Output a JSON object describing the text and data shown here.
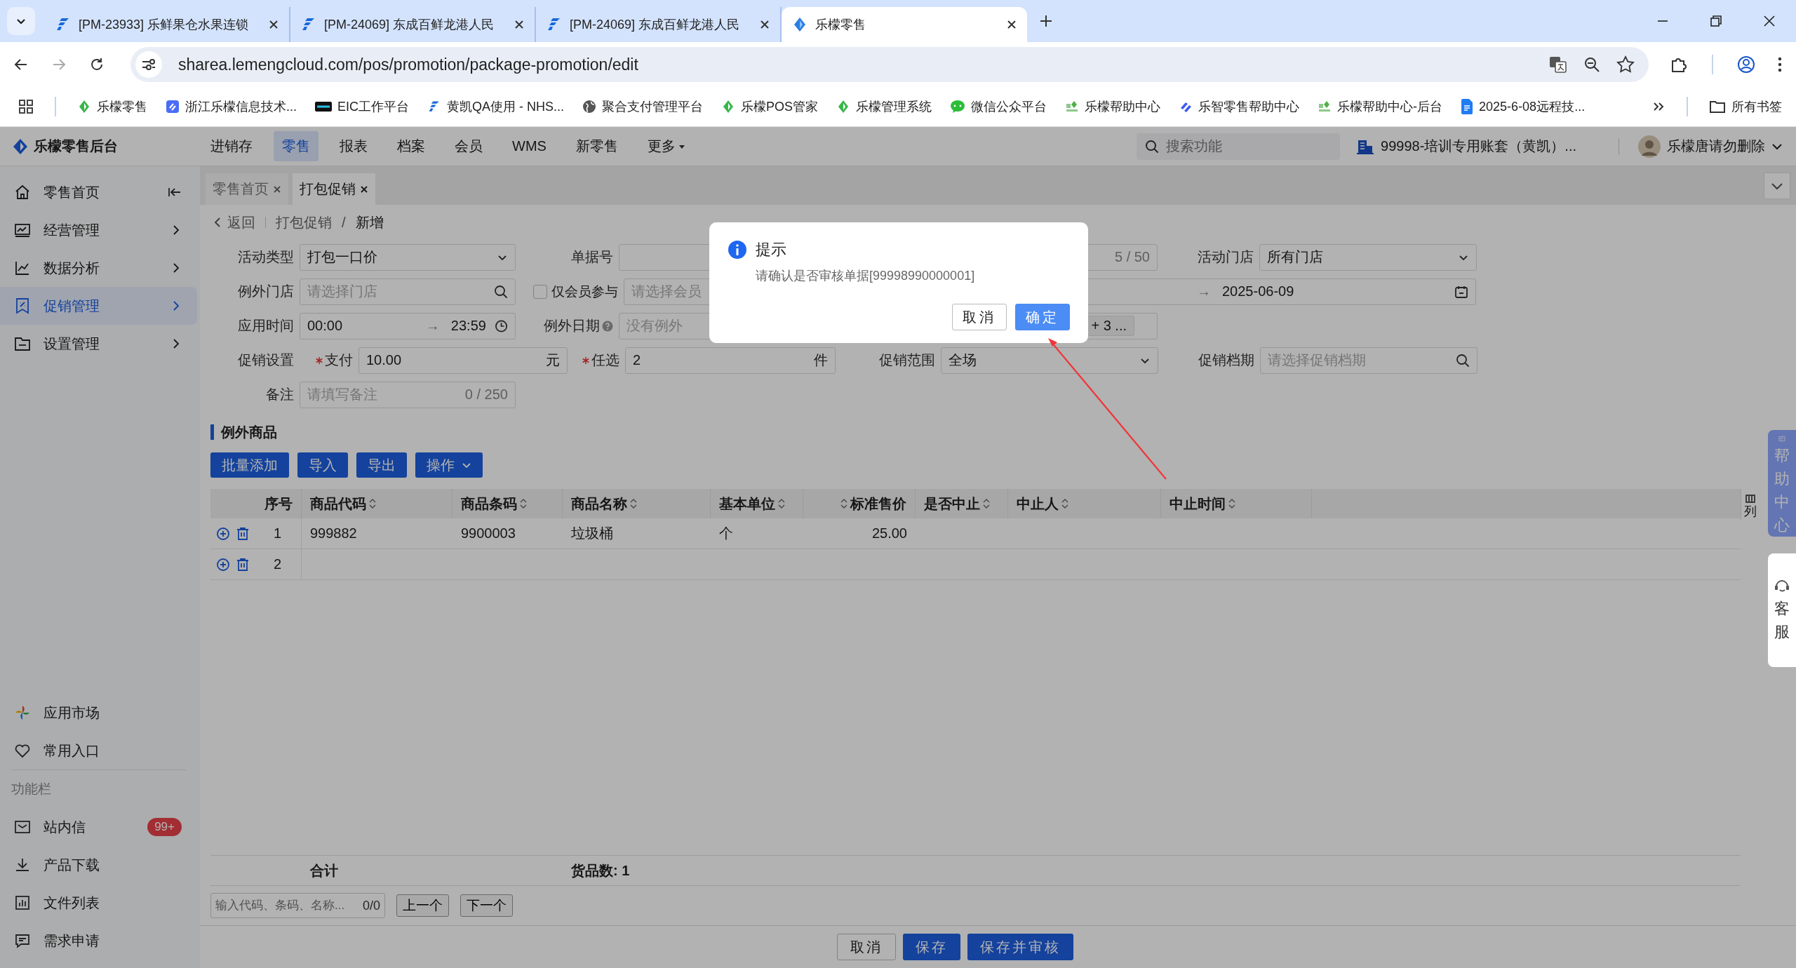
{
  "browser": {
    "tabs": [
      {
        "title": "[PM-23933] 乐鲜果仓水果连锁",
        "selected": false
      },
      {
        "title": "[PM-24069] 东成百鲜龙港人民",
        "selected": false
      },
      {
        "title": "[PM-24069] 东成百鲜龙港人民",
        "selected": false
      },
      {
        "title": "乐檬零售",
        "selected": true
      }
    ],
    "url": "sharea.lemengcloud.com/pos/promotion/package-promotion/edit",
    "bookmarks": [
      "乐檬零售",
      "浙江乐檬信息技术...",
      "EIC工作平台",
      "黄凯QA使用 - NHS...",
      "聚合支付管理平台",
      "乐檬POS管家",
      "乐檬管理系统",
      "微信公众平台",
      "乐檬帮助中心",
      "乐智零售帮助中心",
      "乐檬帮助中心-后台",
      "2025-6-08远程技..."
    ],
    "all_bookmarks": "所有书签"
  },
  "app": {
    "logo": "乐檬零售后台",
    "nav": [
      {
        "label": "进销存",
        "selected": false
      },
      {
        "label": "零售",
        "selected": true
      },
      {
        "label": "报表",
        "selected": false
      },
      {
        "label": "档案",
        "selected": false
      },
      {
        "label": "会员",
        "selected": false
      },
      {
        "label": "WMS",
        "selected": false
      },
      {
        "label": "新零售",
        "selected": false
      },
      {
        "label": "更多",
        "selected": false
      }
    ],
    "search_placeholder": "搜索功能",
    "account": "99998-培训专用账套（黄凯）...",
    "user": "乐檬唐请勿删除"
  },
  "sidebar": {
    "items": [
      {
        "label": "零售首页",
        "selected": false
      },
      {
        "label": "经营管理",
        "selected": false
      },
      {
        "label": "数据分析",
        "selected": false
      },
      {
        "label": "促销管理",
        "selected": true
      },
      {
        "label": "设置管理",
        "selected": false
      }
    ],
    "bottom": [
      "应用市场",
      "常用入口"
    ],
    "section": "功能栏",
    "tools": [
      {
        "label": "站内信",
        "badge": "99+"
      },
      {
        "label": "产品下载"
      },
      {
        "label": "文件列表"
      },
      {
        "label": "需求申请"
      }
    ]
  },
  "page_tabs": [
    {
      "label": "零售首页",
      "selected": false
    },
    {
      "label": "打包促销",
      "selected": true
    }
  ],
  "breadcrumb": {
    "back": "返回",
    "parent": "打包促销",
    "separator": "/",
    "current": "新增"
  },
  "form": {
    "activity_type": {
      "label": "活动类型",
      "value": "打包一口价"
    },
    "doc_no": {
      "label": "单据号",
      "counter": "5 / 50"
    },
    "activity_store": {
      "label": "活动门店",
      "value": "所有门店"
    },
    "exception_store": {
      "label": "例外门店",
      "placeholder": "请选择门店"
    },
    "member_only": {
      "label": "仅会员参与",
      "checked": false
    },
    "member": {
      "placeholder": "请选择会员"
    },
    "date_range": {
      "separator": "→",
      "end": "2025-06-09"
    },
    "apply_time": {
      "label": "应用时间",
      "start": "00:00",
      "separator": "→",
      "end": "23:59"
    },
    "exception_date": {
      "label": "例外日期",
      "placeholder": "没有例外",
      "tag": "+ 3 ..."
    },
    "promo_setting": {
      "label": "促销设置"
    },
    "pay": {
      "label": "支付",
      "required": true,
      "value": "10.00",
      "suffix": "元"
    },
    "choose": {
      "label": "任选",
      "required": true,
      "value": "2",
      "suffix": "件"
    },
    "scope": {
      "label": "促销范围",
      "value": "全场"
    },
    "period": {
      "label": "促销档期",
      "placeholder": "请选择促销档期"
    },
    "remark": {
      "label": "备注",
      "placeholder": "请填写备注",
      "counter": "0 / 250"
    }
  },
  "exception_goods": {
    "title": "例外商品",
    "buttons": [
      "批量添加",
      "导入",
      "导出",
      "操作"
    ],
    "columns": [
      {
        "label": "序号",
        "sortable": false,
        "kind": "index"
      },
      {
        "label": "商品代码",
        "sortable": true,
        "kind": "text"
      },
      {
        "label": "商品条码",
        "sortable": true,
        "kind": "text"
      },
      {
        "label": "商品名称",
        "sortable": true,
        "kind": "text"
      },
      {
        "label": "基本单位",
        "sortable": true,
        "kind": "text"
      },
      {
        "label": "标准售价",
        "sortable": true,
        "kind": "number"
      },
      {
        "label": "是否中止",
        "sortable": true,
        "kind": "text"
      },
      {
        "label": "中止人",
        "sortable": true,
        "kind": "text"
      },
      {
        "label": "中止时间",
        "sortable": true,
        "kind": "text"
      }
    ],
    "column_settings": "列",
    "rows": [
      {
        "no": "1",
        "cells": [
          "999882",
          "9900003",
          "垃圾桶",
          "个",
          "25.00"
        ]
      },
      {
        "no": "2"
      }
    ],
    "total_label": "合计",
    "count": "货品数: 1",
    "find_placeholder": "输入代码、条码、名称...",
    "find_count": "0/0",
    "prev": "上一个",
    "next": "下一个"
  },
  "footer_buttons": [
    "取消",
    "保存",
    "保存并审核"
  ],
  "side_widgets": {
    "help": "帮助中心",
    "service": "客服"
  },
  "dialog": {
    "title": "提示",
    "message": "请确认是否审核单据[99998990000001]",
    "buttons": [
      "取消",
      "确定"
    ]
  }
}
